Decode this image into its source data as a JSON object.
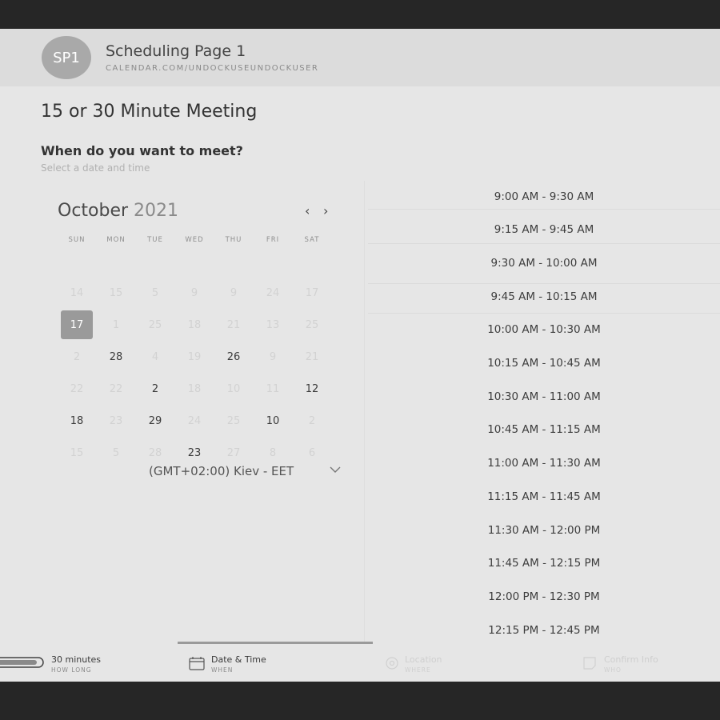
{
  "header": {
    "avatar_initials": "SP1",
    "title": "Scheduling Page 1",
    "url": "CALENDAR.COM/UNDOCKUSEUNDOCKUSER"
  },
  "meeting": {
    "title": "15 or 30 Minute Meeting",
    "question": "When do you want to meet?",
    "subtitle": "Select a date and time"
  },
  "calendar": {
    "month": "October",
    "year": "2021",
    "prev_icon": "chevron-left-icon",
    "next_icon": "chevron-right-icon",
    "weekdays": [
      "SUN",
      "MON",
      "TUE",
      "WED",
      "THU",
      "FRI",
      "SAT"
    ],
    "weeks": [
      [
        {
          "d": "14",
          "s": "dim"
        },
        {
          "d": "15",
          "s": "dim"
        },
        {
          "d": "5",
          "s": "dim"
        },
        {
          "d": "9",
          "s": "dim"
        },
        {
          "d": "9",
          "s": "dim"
        },
        {
          "d": "24",
          "s": "dim"
        },
        {
          "d": "17",
          "s": "dim"
        }
      ],
      [
        {
          "d": "17",
          "s": "selected"
        },
        {
          "d": "1",
          "s": "dim"
        },
        {
          "d": "25",
          "s": "dim"
        },
        {
          "d": "18",
          "s": "dim"
        },
        {
          "d": "21",
          "s": "dim"
        },
        {
          "d": "13",
          "s": "dim"
        },
        {
          "d": "25",
          "s": "dim"
        }
      ],
      [
        {
          "d": "2",
          "s": "dim"
        },
        {
          "d": "28",
          "s": "avail"
        },
        {
          "d": "4",
          "s": "dim"
        },
        {
          "d": "19",
          "s": "dim"
        },
        {
          "d": "26",
          "s": "avail"
        },
        {
          "d": "9",
          "s": "dim"
        },
        {
          "d": "21",
          "s": "dim"
        }
      ],
      [
        {
          "d": "22",
          "s": "dim"
        },
        {
          "d": "22",
          "s": "dim"
        },
        {
          "d": "2",
          "s": "avail"
        },
        {
          "d": "18",
          "s": "dim"
        },
        {
          "d": "10",
          "s": "dim"
        },
        {
          "d": "11",
          "s": "dim"
        },
        {
          "d": "12",
          "s": "avail"
        }
      ],
      [
        {
          "d": "18",
          "s": "avail"
        },
        {
          "d": "23",
          "s": "dim"
        },
        {
          "d": "29",
          "s": "avail"
        },
        {
          "d": "24",
          "s": "dim"
        },
        {
          "d": "25",
          "s": "dim"
        },
        {
          "d": "10",
          "s": "avail"
        },
        {
          "d": "2",
          "s": "dim"
        }
      ],
      [
        {
          "d": "15",
          "s": "dim"
        },
        {
          "d": "5",
          "s": "dim"
        },
        {
          "d": "28",
          "s": "dim"
        },
        {
          "d": "23",
          "s": "avail"
        },
        {
          "d": "27",
          "s": "dim"
        },
        {
          "d": "8",
          "s": "dim"
        },
        {
          "d": "6",
          "s": "dim"
        }
      ]
    ],
    "timezone": "(GMT+02:00) Kiev - EET",
    "timezone_icon": "chevron-down-icon"
  },
  "time_slots": [
    "9:00 AM - 9:30 AM",
    "9:15 AM - 9:45 AM",
    "9:30 AM - 10:00 AM",
    "9:45 AM - 10:15 AM",
    "10:00 AM - 10:30 AM",
    "10:15 AM - 10:45 AM",
    "10:30 AM - 11:00 AM",
    "10:45 AM - 11:15 AM",
    "11:00 AM - 11:30 AM",
    "11:15 AM - 11:45 AM",
    "11:30 AM - 12:00 PM",
    "11:45 AM - 12:15 PM",
    "12:00 PM - 12:30 PM",
    "12:15 PM - 12:45 PM"
  ],
  "steps": [
    {
      "label": "30 minutes",
      "sub": "HOW LONG",
      "icon": "toggle-icon",
      "state": "done"
    },
    {
      "label": "Date & Time",
      "sub": "WHEN",
      "icon": "calendar-icon",
      "state": "active"
    },
    {
      "label": "Location",
      "sub": "WHERE",
      "icon": "location-icon",
      "state": "pending"
    },
    {
      "label": "Confirm Info",
      "sub": "WHO",
      "icon": "form-icon",
      "state": "pending"
    }
  ]
}
